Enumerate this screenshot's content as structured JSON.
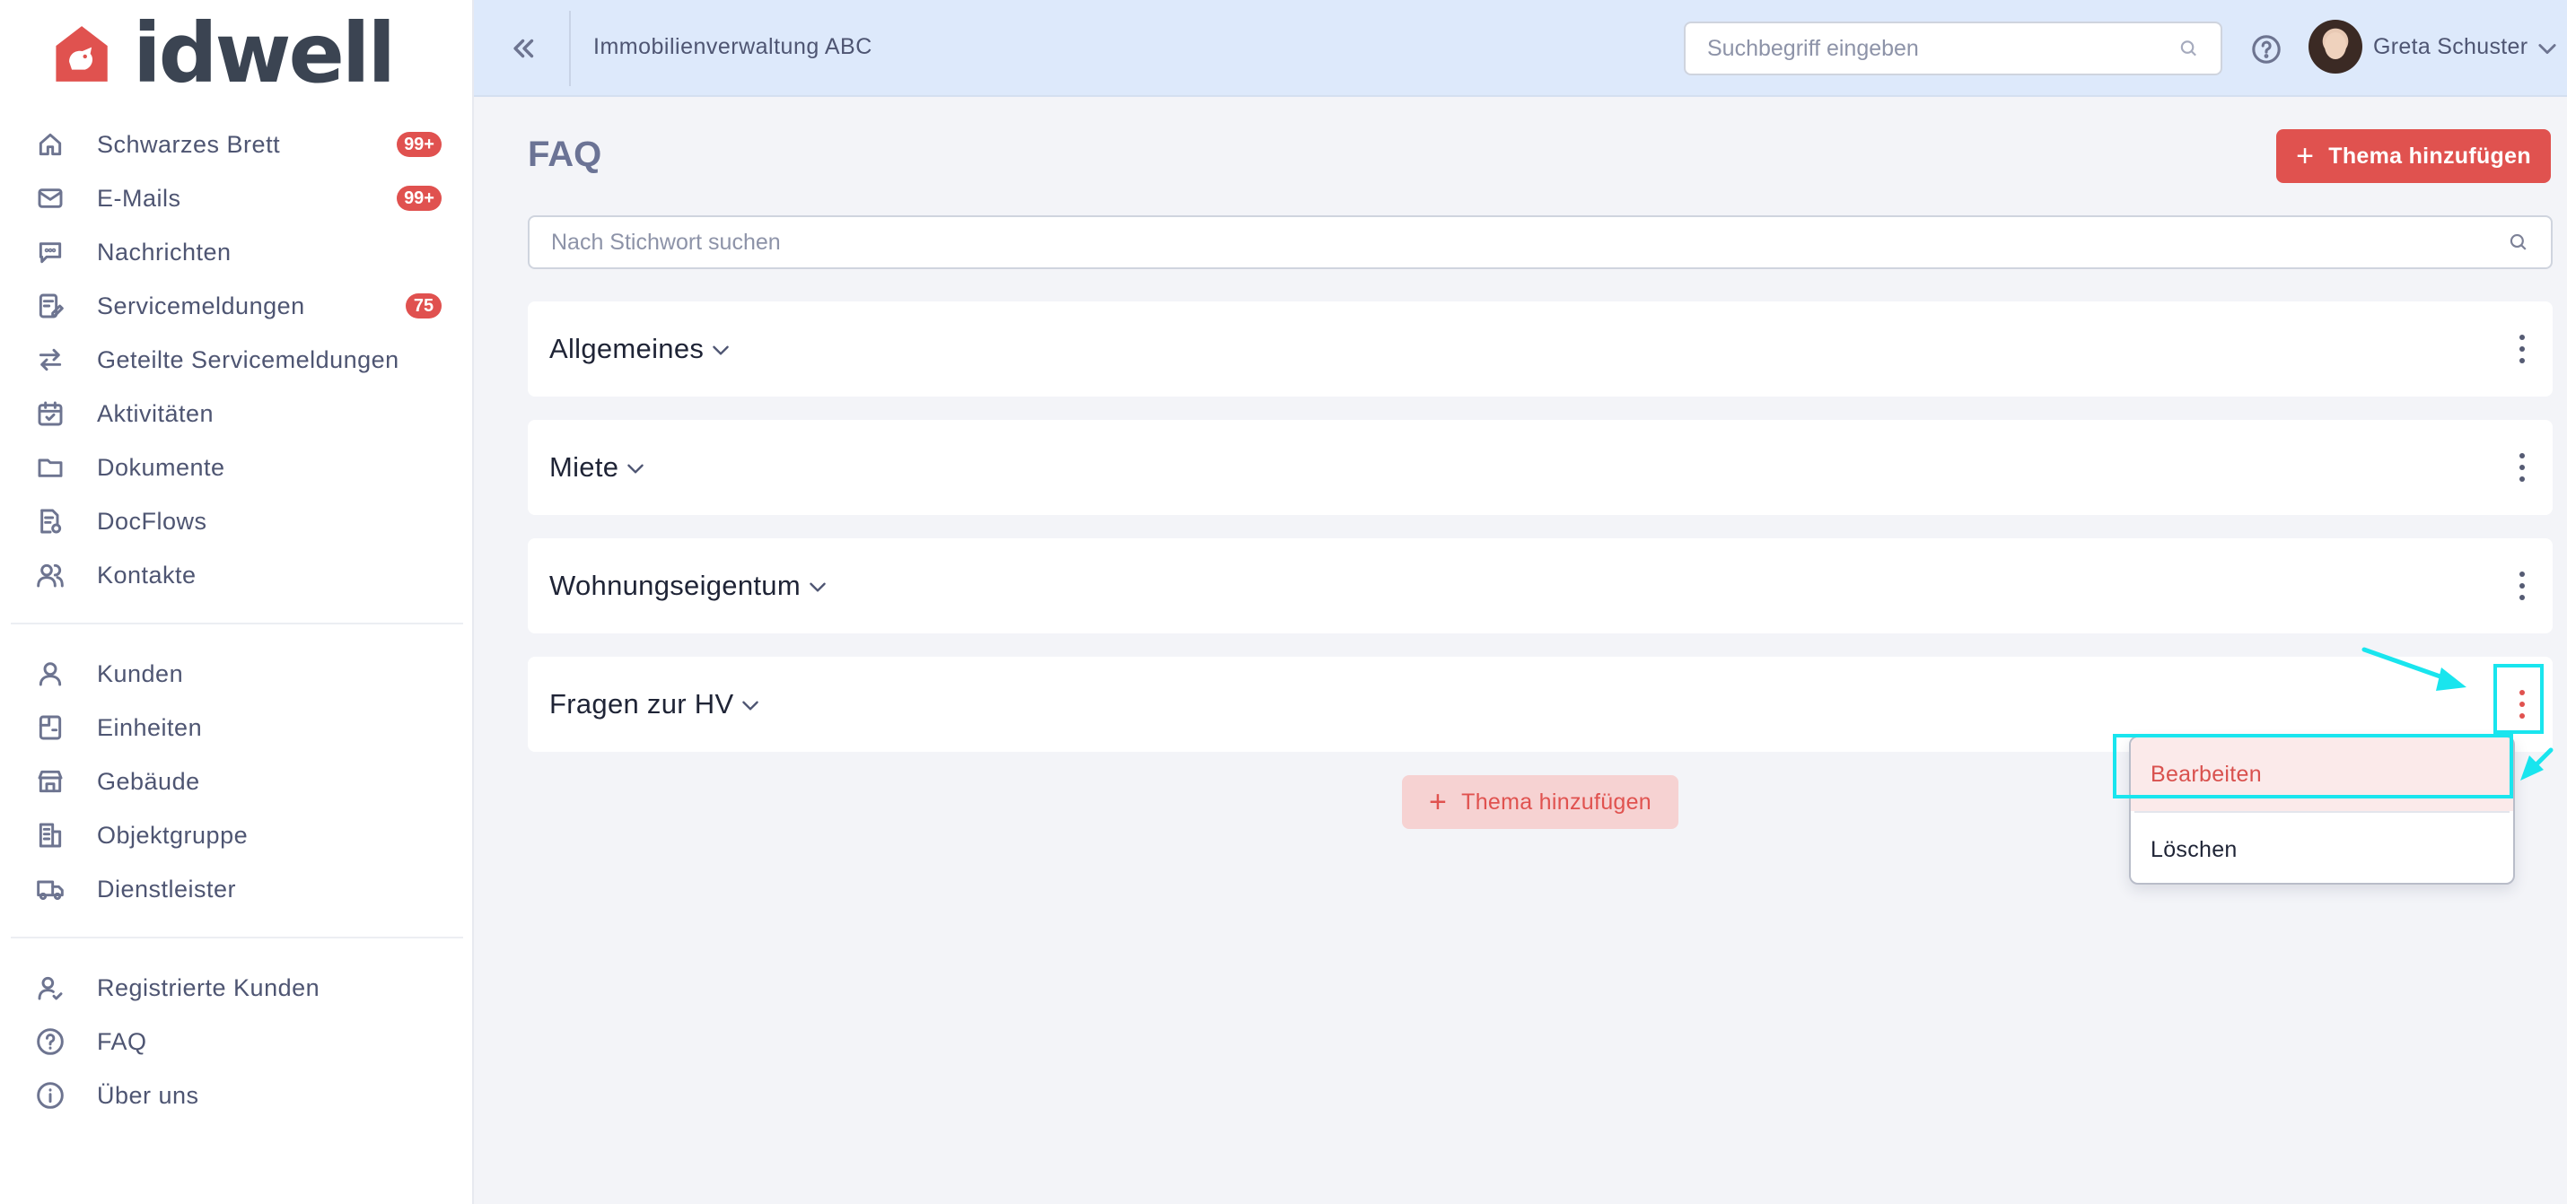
{
  "brand": {
    "name": "idwell",
    "accent": "#e0524f"
  },
  "sidebar": {
    "groups": [
      [
        {
          "label": "Schwarzes Brett",
          "icon": "home-icon",
          "badge": "99+"
        },
        {
          "label": "E-Mails",
          "icon": "mail-icon",
          "badge": "99+"
        },
        {
          "label": "Nachrichten",
          "icon": "chat-icon",
          "badge": null
        },
        {
          "label": "Servicemeldungen",
          "icon": "service-icon",
          "badge": "75"
        },
        {
          "label": "Geteilte Servicemeldungen",
          "icon": "swap-icon",
          "badge": null
        },
        {
          "label": "Aktivitäten",
          "icon": "calendar-check-icon",
          "badge": null
        },
        {
          "label": "Dokumente",
          "icon": "folder-icon",
          "badge": null
        },
        {
          "label": "DocFlows",
          "icon": "docflow-icon",
          "badge": null
        },
        {
          "label": "Kontakte",
          "icon": "users-icon",
          "badge": null
        }
      ],
      [
        {
          "label": "Kunden",
          "icon": "user-icon",
          "badge": null
        },
        {
          "label": "Einheiten",
          "icon": "unit-icon",
          "badge": null
        },
        {
          "label": "Gebäude",
          "icon": "store-icon",
          "badge": null
        },
        {
          "label": "Objektgruppe",
          "icon": "building-icon",
          "badge": null
        },
        {
          "label": "Dienstleister",
          "icon": "truck-icon",
          "badge": null
        }
      ],
      [
        {
          "label": "Registrierte Kunden",
          "icon": "user-check-icon",
          "badge": null
        },
        {
          "label": "FAQ",
          "icon": "question-circle-icon",
          "badge": null
        },
        {
          "label": "Über uns",
          "icon": "info-icon",
          "badge": null
        }
      ]
    ]
  },
  "topbar": {
    "org_name": "Immobilienverwaltung ABC",
    "search_placeholder": "Suchbegriff eingeben",
    "user_name": "Greta Schuster"
  },
  "main": {
    "title": "FAQ",
    "add_button_label": "Thema hinzufügen",
    "keyword_placeholder": "Nach Stichwort suchen",
    "topics": [
      {
        "title": "Allgemeines"
      },
      {
        "title": "Miete"
      },
      {
        "title": "Wohnungseigentum"
      },
      {
        "title": "Fragen zur HV"
      }
    ],
    "secondary_add_label": "Thema hinzufügen"
  },
  "context_menu": {
    "items": [
      {
        "label": "Bearbeiten",
        "highlighted": true
      },
      {
        "label": "Löschen",
        "highlighted": false
      }
    ]
  },
  "annotation_color": "#19e5ee"
}
